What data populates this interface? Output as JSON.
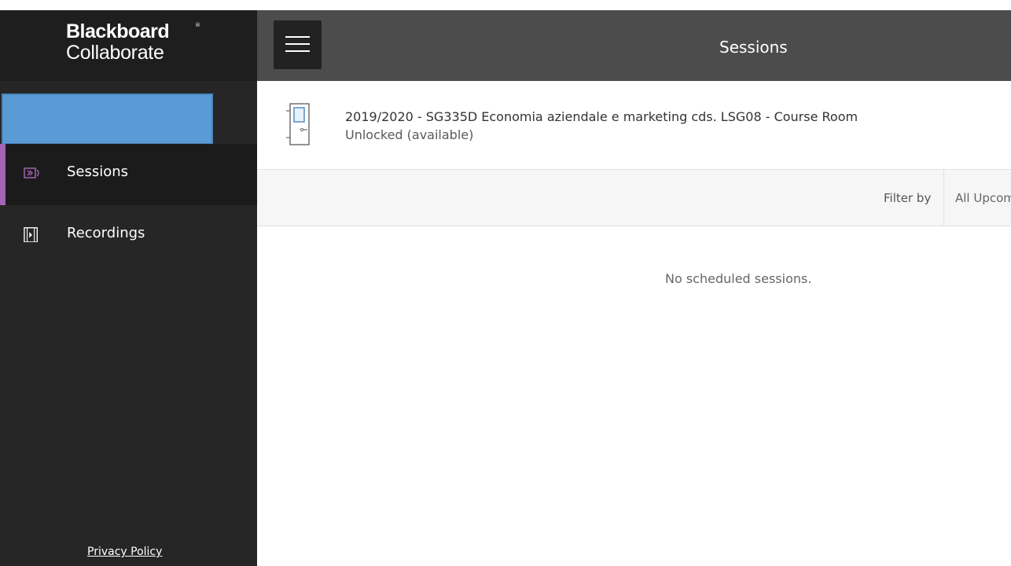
{
  "brand": {
    "line1": "Blackboard",
    "line2": "Collaborate",
    "mark": "®"
  },
  "sidebar": {
    "items": [
      {
        "label": "Sessions",
        "icon": "sessions-icon",
        "active": true
      },
      {
        "label": "Recordings",
        "icon": "recordings-icon",
        "active": false
      }
    ],
    "privacy": "Privacy Policy",
    "accent_color": "#a463b5"
  },
  "header": {
    "title": "Sessions",
    "menu_icon": "hamburger-icon"
  },
  "room": {
    "title": "2019/2020 - SG335D Economia aziendale e marketing cds. LSG08 - Course Room",
    "status": "Unlocked (available)",
    "icon": "door-icon"
  },
  "filter": {
    "label": "Filter by",
    "value": "All Upcoming"
  },
  "empty_message": "No scheduled sessions."
}
